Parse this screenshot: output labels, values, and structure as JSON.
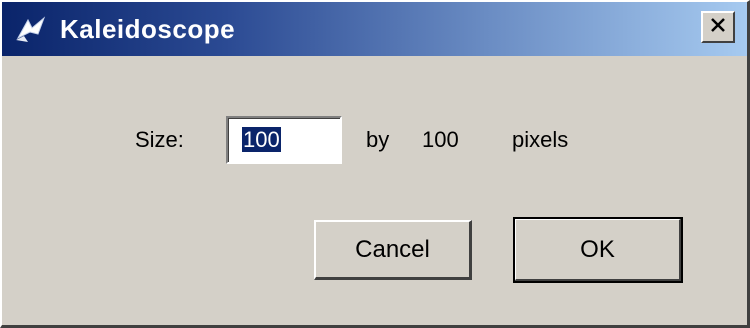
{
  "window": {
    "title": "Kaleidoscope",
    "app_icon": "kaleidoscope-icon",
    "close_icon": "close-icon"
  },
  "form": {
    "size_label": "Size:",
    "width_value": "100",
    "by_label": "by",
    "height_value": "100",
    "unit_label": "pixels"
  },
  "buttons": {
    "cancel_label": "Cancel",
    "ok_label": "OK"
  },
  "colors": {
    "titlebar_start": "#0a246a",
    "titlebar_end": "#a6caf0",
    "face": "#d4d0c8",
    "selection": "#0a246a"
  }
}
